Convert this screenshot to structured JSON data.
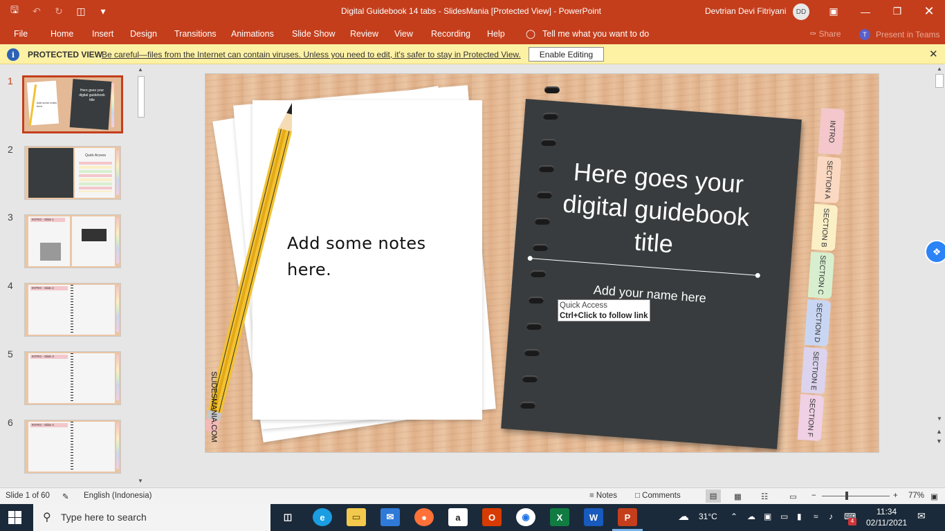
{
  "app": {
    "doc_title": "Digital Guidebook 14 tabs  -  SlidesMania [Protected View]  -  PowerPoint",
    "user_name": "Devtrian Devi Fitriyani",
    "user_initials": "DD"
  },
  "ribbon": {
    "file": "File",
    "tabs": [
      "Home",
      "Insert",
      "Design",
      "Transitions",
      "Animations",
      "Slide Show",
      "Review",
      "View",
      "Recording",
      "Help"
    ],
    "tell_me": "Tell me what you want to do",
    "share": "Share",
    "present_teams": "Present in Teams"
  },
  "protected_view": {
    "label": "PROTECTED VIEW",
    "message": "Be careful—files from the Internet can contain viruses. Unless you need to edit, it's safer to stay in Protected View.",
    "enable_button": "Enable Editing"
  },
  "thumbnails": {
    "numbers": [
      "1",
      "2",
      "3",
      "4",
      "5",
      "6"
    ],
    "mini_title": "Here goes your digital guidebook title",
    "mini_notes": "Add some notes here.",
    "quick_access": "Quick Access",
    "slide3_label": "INTRO - Slide 1",
    "slide4_label": "INTRO - Slide 2",
    "slide5_label": "INTRO - Slide 3",
    "slide6_label": "INTRO - Slide 4"
  },
  "slide": {
    "notes": "Add some notes here.",
    "title": "Here goes your digital guidebook title",
    "name": "Add your name here",
    "brand": "SLIDESMANIA.COM",
    "tabs": [
      {
        "label": "INTRO",
        "color": "#f3c7cb"
      },
      {
        "label": "SECTION A",
        "color": "#fad8c1"
      },
      {
        "label": "SECTION B",
        "color": "#fbefc6"
      },
      {
        "label": "SECTION C",
        "color": "#d8efcf"
      },
      {
        "label": "SECTION D",
        "color": "#c9d6f3"
      },
      {
        "label": "SECTION E",
        "color": "#dcd3ee"
      },
      {
        "label": "SECTION F",
        "color": "#efd0e4"
      }
    ]
  },
  "tooltip": {
    "title": "Quick Access",
    "hint": "Ctrl+Click to follow link"
  },
  "statusbar": {
    "slide_info": "Slide 1 of 60",
    "language": "English (Indonesia)",
    "notes": "Notes",
    "comments": "Comments",
    "zoom": "77%",
    "zoom_minus": "−",
    "zoom_plus": "+"
  },
  "taskbar": {
    "search_placeholder": "Type here to search",
    "temperature": "31°C",
    "time": "11:34",
    "date": "02/11/2021",
    "notification_count": "4"
  }
}
